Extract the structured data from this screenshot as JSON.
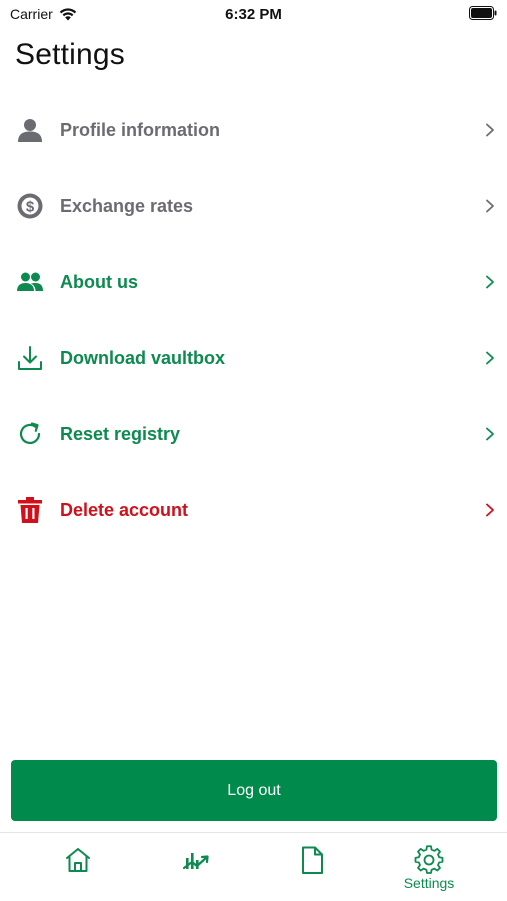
{
  "status_bar": {
    "carrier": "Carrier",
    "time": "6:32 PM"
  },
  "page": {
    "title": "Settings"
  },
  "settings": {
    "items": [
      {
        "label": "Profile information",
        "icon": "person-icon",
        "tone": "muted"
      },
      {
        "label": "Exchange rates",
        "icon": "dollar-coin-icon",
        "tone": "muted"
      },
      {
        "label": "About us",
        "icon": "people-icon",
        "tone": "green"
      },
      {
        "label": "Download vaultbox",
        "icon": "download-icon",
        "tone": "green"
      },
      {
        "label": "Reset registry",
        "icon": "refresh-icon",
        "tone": "green"
      },
      {
        "label": "Delete account",
        "icon": "trash-icon",
        "tone": "danger"
      }
    ]
  },
  "actions": {
    "logout_label": "Log out"
  },
  "tab_bar": {
    "tabs": [
      {
        "name": "home",
        "icon": "home-icon",
        "label": ""
      },
      {
        "name": "chart",
        "icon": "chart-icon",
        "label": ""
      },
      {
        "name": "document",
        "icon": "document-icon",
        "label": ""
      },
      {
        "name": "settings",
        "icon": "gear-icon",
        "label": "Settings",
        "active": true
      }
    ]
  },
  "colors": {
    "accent_green": "#008a4c",
    "muted_gray": "#6b6b72",
    "danger_red": "#d0101b"
  }
}
